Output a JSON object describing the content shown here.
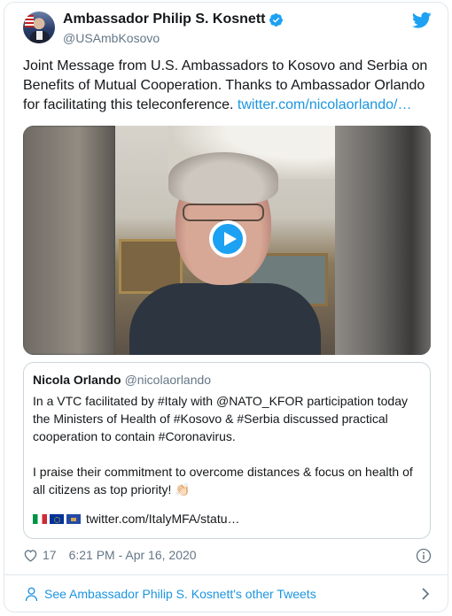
{
  "author": {
    "name": "Ambassador Philip S. Kosnett",
    "handle": "@USAmbKosovo",
    "verified_icon": "verified-badge-icon"
  },
  "tweet": {
    "text": "Joint Message from U.S. Ambassadors to Kosovo and Serbia on Benefits of Mutual Cooperation. Thanks to Ambassador Orlando for facilitating this teleconference. ",
    "link": "twitter.com/nicolaorlando/…"
  },
  "video": {
    "play_icon": "play-icon"
  },
  "quoted_tweet": {
    "name": "Nicola Orlando",
    "handle": "@nicolaorlando",
    "text": "In a VTC facilitated by #Italy with @NATO_KFOR participation today the Ministers of Health of #Kosovo & #Serbia discussed practical cooperation to contain #Coronavirus.\n\nI praise their commitment to overcome distances & focus on health of all citizens as top priority! 👏🏻",
    "link": "twitter.com/ItalyMFA/statu…"
  },
  "meta": {
    "likes": "17",
    "timestamp": "6:21 PM - Apr 16, 2020"
  },
  "footer": {
    "label": "See Ambassador Philip S. Kosnett's other Tweets"
  },
  "colors": {
    "link": "#1b95e0",
    "play_button": "#1da1f2",
    "secondary_text": "#657786"
  }
}
